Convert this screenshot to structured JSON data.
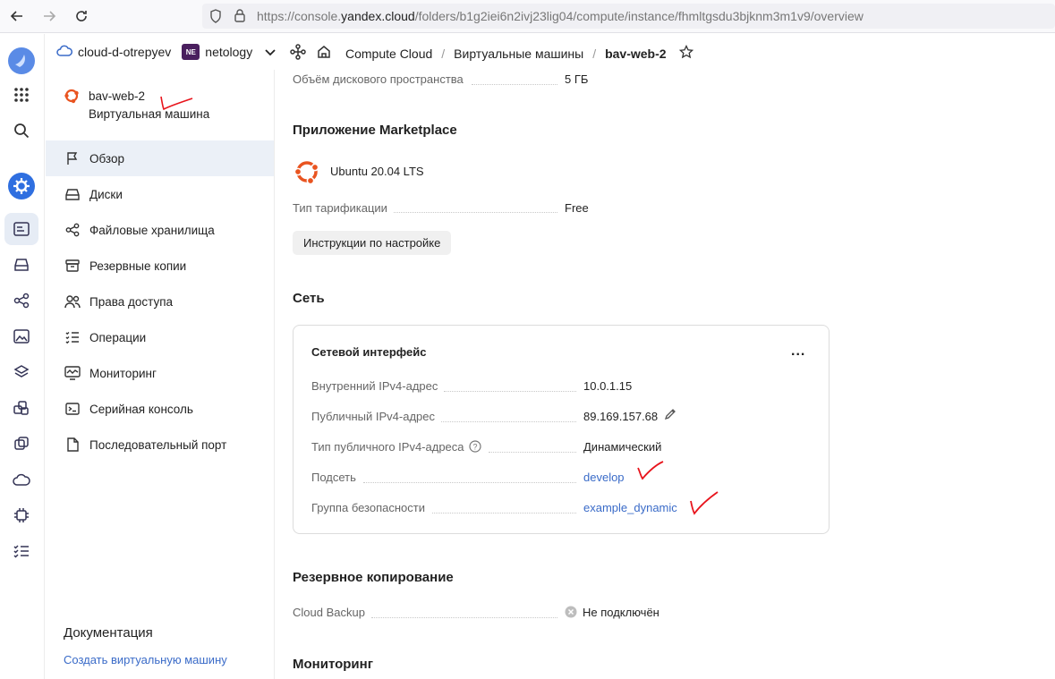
{
  "browser": {
    "url_prefix": "https://console.",
    "url_domain": "yandex.cloud",
    "url_path": "/folders/b1g2iei6n2ivj23lig04/compute/instance/fhmltgsdu3bjknm3m1v9/overview"
  },
  "header": {
    "cloud_name": "cloud-d-otrepyev",
    "org_badge": "NE",
    "org_name": "netology",
    "breadcrumbs": [
      "Compute Cloud",
      "Виртуальные машины",
      "bav-web-2"
    ]
  },
  "sidebar": {
    "vm_name": "bav-web-2",
    "vm_type": "Виртуальная машина",
    "items": [
      {
        "label": "Обзор",
        "icon": "flag-icon"
      },
      {
        "label": "Диски",
        "icon": "disk-icon"
      },
      {
        "label": "Файловые хранилища",
        "icon": "share-icon"
      },
      {
        "label": "Резервные копии",
        "icon": "backup-icon"
      },
      {
        "label": "Права доступа",
        "icon": "users-icon"
      },
      {
        "label": "Операции",
        "icon": "list-icon"
      },
      {
        "label": "Мониторинг",
        "icon": "monitor-icon"
      },
      {
        "label": "Серийная консоль",
        "icon": "terminal-icon"
      },
      {
        "label": "Последовательный порт",
        "icon": "file-icon"
      }
    ],
    "docs_title": "Документация",
    "docs_link": "Создать виртуальную машину"
  },
  "main": {
    "disk_label": "Объём дискового пространства",
    "disk_value": "5 ГБ",
    "marketplace_title": "Приложение Marketplace",
    "marketplace_app": "Ubuntu 20.04 LTS",
    "tariff_label": "Тип тарификации",
    "tariff_value": "Free",
    "instructions_button": "Инструкции по настройке",
    "network_title": "Сеть",
    "nic_title": "Сетевой интерфейс",
    "nic_menu": "...",
    "internal_ip_label": "Внутренний IPv4-адрес",
    "internal_ip_value": "10.0.1.15",
    "public_ip_label": "Публичный IPv4-адрес",
    "public_ip_value": "89.169.157.68",
    "public_ip_type_label": "Тип публичного IPv4-адреса",
    "public_ip_type_value": "Динамический",
    "subnet_label": "Подсеть",
    "subnet_value": "develop",
    "sg_label": "Группа безопасности",
    "sg_value": "example_dynamic",
    "backup_title": "Резервное копирование",
    "backup_label": "Cloud Backup",
    "backup_value": "Не подключён",
    "monitoring_title": "Мониторинг"
  },
  "colors": {
    "accent": "#3a6bc8",
    "ubuntu": "#e95420",
    "annotation": "#e8141c"
  }
}
